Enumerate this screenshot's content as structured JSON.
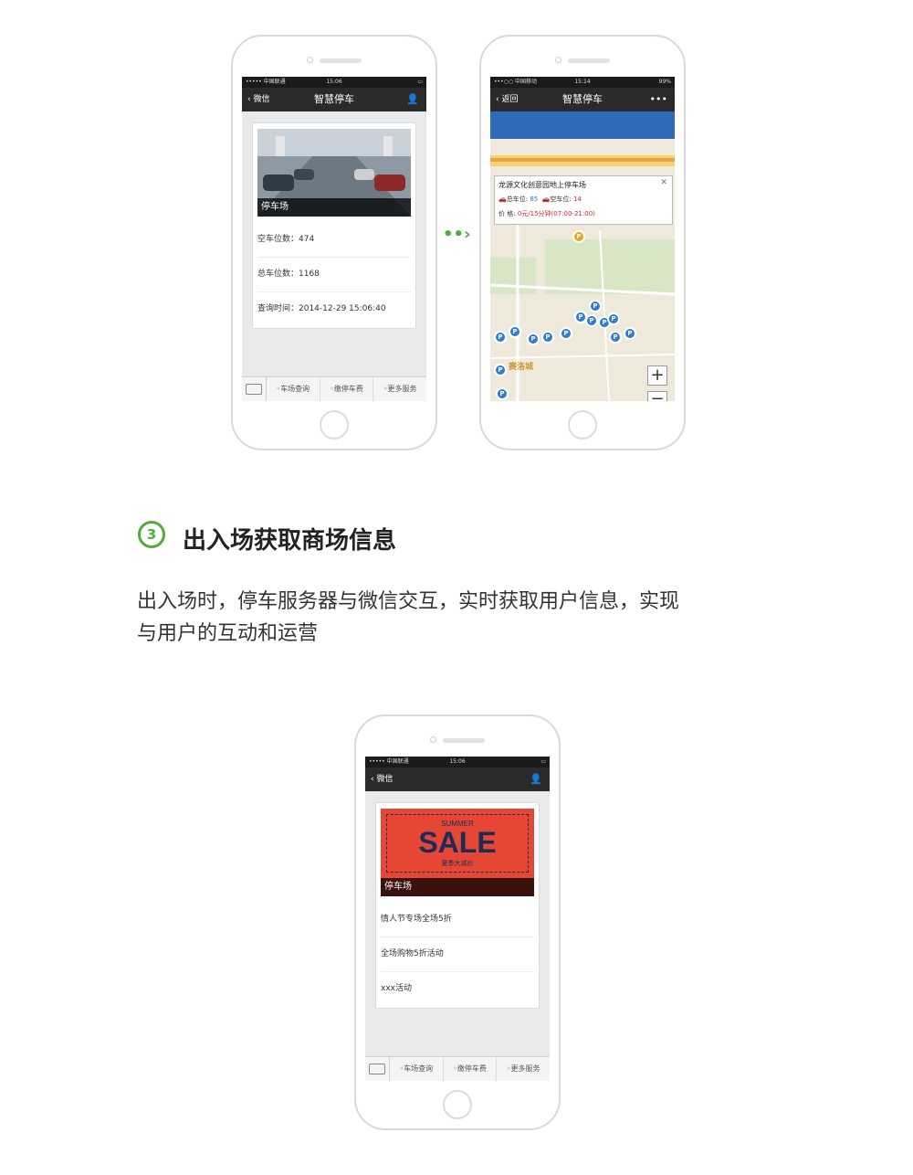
{
  "colors": {
    "accent": "#4fae3a",
    "map_header": "#2e6ab8",
    "sale_red": "#e64634",
    "sale_navy": "#1c2c5a"
  },
  "menu": {
    "items": [
      "车场查询",
      "缴停车费",
      "更多服务"
    ]
  },
  "phone1": {
    "status": {
      "carrier": "••••• 中国联通",
      "time": "15:06"
    },
    "nav": {
      "back": "微信",
      "title": "智慧停车"
    },
    "banner_caption": "停车场",
    "rows": [
      "空车位数：474",
      "总车位数：1168",
      "查询时间：2014-12-29 15:06:40"
    ]
  },
  "phone2": {
    "status": {
      "carrier": "•••○○ 中国移动",
      "time": "15:14",
      "battery": "99%"
    },
    "nav": {
      "back": "返回",
      "title": "智慧停车",
      "more": "•••"
    },
    "popup": {
      "title": "龙源文化创意园地上停车场",
      "total_label": "总车位:",
      "total": "85",
      "empty_label": "空车位:",
      "empty": "14",
      "price_label": "价 格:",
      "price": "0元/15分钟(07:00-21:00)"
    },
    "map_labels": [
      "赛洛城",
      "P"
    ]
  },
  "section": {
    "number": "3",
    "title": "出入场获取商场信息",
    "desc_line1": "出入场时，停车服务器与微信交互，实时获取用户信息，实现",
    "desc_line2": "与用户的互动和运营"
  },
  "phone3": {
    "status": {
      "carrier": "••••• 中国联通",
      "time": "15:06"
    },
    "nav": {
      "back": "微信"
    },
    "sale": {
      "top": "SUMMER",
      "main": "SALE",
      "sub": "夏季大减价"
    },
    "banner_caption": "停车场",
    "rows": [
      "情人节专场全场5折",
      "全场购物5折活动",
      "xxx活动"
    ]
  }
}
